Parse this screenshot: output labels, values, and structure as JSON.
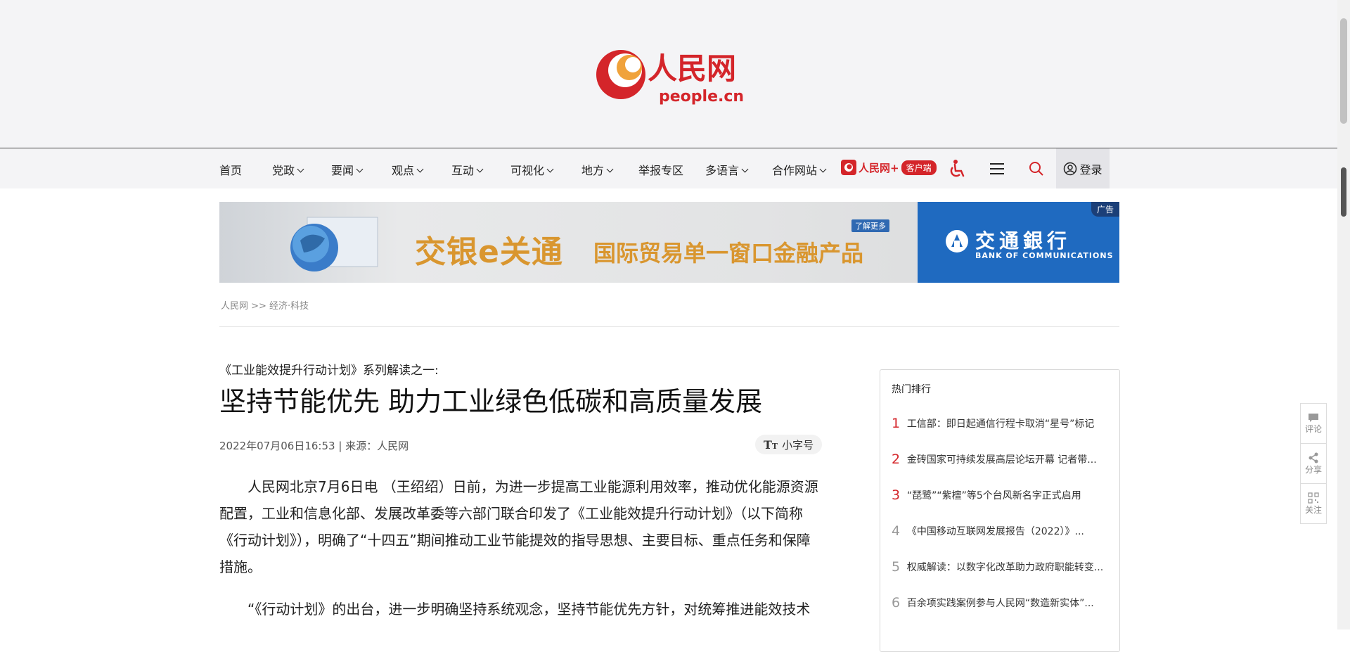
{
  "header": {
    "logo_cn": "人民网",
    "logo_en": "people.cn"
  },
  "nav": {
    "items": [
      {
        "label": "首页",
        "has_dropdown": false
      },
      {
        "label": "党政",
        "has_dropdown": true
      },
      {
        "label": "要闻",
        "has_dropdown": true
      },
      {
        "label": "观点",
        "has_dropdown": true
      },
      {
        "label": "互动",
        "has_dropdown": true
      },
      {
        "label": "可视化",
        "has_dropdown": true
      },
      {
        "label": "地方",
        "has_dropdown": true
      },
      {
        "label": "举报专区",
        "has_dropdown": false
      },
      {
        "label": "多语言",
        "has_dropdown": true
      },
      {
        "label": "合作网站",
        "has_dropdown": true
      }
    ],
    "app_brand": "人民网+",
    "app_badge": "客户端",
    "accessibility_icon": "wheelchair-icon",
    "menu_icon": "hamburger-icon",
    "search_icon": "search-icon",
    "login_label": "登录"
  },
  "ad": {
    "title": "交银e关通",
    "subtitle": "国际贸易单一窗口金融产品",
    "more_label": "了解更多",
    "bank_name": "交通銀行",
    "bank_en": "BANK OF COMMUNICATIONS",
    "ad_tag": "广告"
  },
  "breadcrumb": "人民网 >> 经济·科技",
  "article": {
    "pre_title": "《工业能效提升行动计划》系列解读之一:",
    "title": "坚持节能优先 助力工业绿色低碳和高质量发展",
    "meta": "2022年07月06日16:53 | 来源：人民网",
    "font_toggle_label": "小字号",
    "paragraphs": [
      "人民网北京7月6日电 （王绍绍）日前，为进一步提高工业能源利用效率，推动优化能源资源配置，工业和信息化部、发展改革委等六部门联合印发了《工业能效提升行动计划》（以下简称《行动计划》），明确了“十四五”期间推动工业节能提效的指导思想、主要目标、重点任务和保障措施。",
      "“《行动计划》的出台，进一步明确坚持系统观念，坚持节能优先方针，对统筹推进能效技术"
    ]
  },
  "sidebar": {
    "title": "热门排行",
    "items": [
      {
        "rank": "1",
        "text": "工信部：即日起通信行程卡取消“星号”标记"
      },
      {
        "rank": "2",
        "text": "金砖国家可持续发展高层论坛开幕 记者带..."
      },
      {
        "rank": "3",
        "text": "“琵鹭”“紫檀”等5个台风新名字正式启用"
      },
      {
        "rank": "4",
        "text": "《中国移动互联网发展报告（2022）》..."
      },
      {
        "rank": "5",
        "text": "权威解读：以数字化改革助力政府职能转变..."
      },
      {
        "rank": "6",
        "text": "百余项实践案例参与人民网“数造新实体”..."
      }
    ]
  },
  "floatbar": {
    "comment": "评论",
    "share": "分享",
    "follow": "关注"
  },
  "colors": {
    "brand_red": "#d4252a",
    "nav_bg": "#f4f4f6",
    "rank_top": "#d4252a",
    "rank_rest": "#999999"
  }
}
